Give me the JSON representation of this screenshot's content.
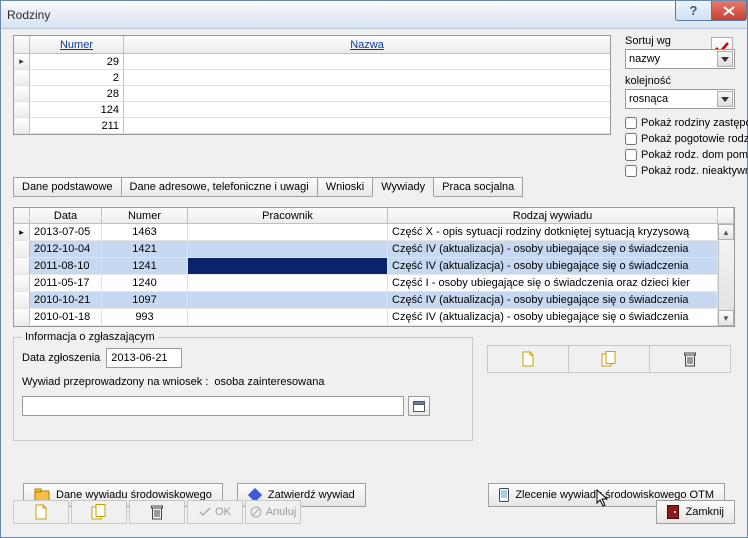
{
  "title": "Rodziny",
  "top_table": {
    "col_numer": "Numer",
    "col_nazwa": "Nazwa",
    "rows": [
      {
        "numer": "29",
        "nazwa": ""
      },
      {
        "numer": "2",
        "nazwa": ""
      },
      {
        "numer": "28",
        "nazwa": ""
      },
      {
        "numer": "124",
        "nazwa": ""
      },
      {
        "numer": "211",
        "nazwa": ""
      }
    ]
  },
  "sort": {
    "label": "Sortuj wg",
    "value": "nazwy",
    "order_label": "kolejność",
    "order_value": "rosnąca"
  },
  "checks": {
    "c1": "Pokaż rodziny zastępcze",
    "c2": "Pokaż pogotowie rodzinne",
    "c3": "Pokaż rodz. dom pomocy",
    "c4": "Pokaż rodz. nieaktywne"
  },
  "tabs": {
    "t1": "Dane podstawowe",
    "t2": "Dane adresowe, telefoniczne i uwagi",
    "t3": "Wnioski",
    "t4": "Wywiady",
    "t5": "Praca socjalna"
  },
  "grid": {
    "h_data": "Data",
    "h_numer": "Numer",
    "h_pracownik": "Pracownik",
    "h_rodzaj": "Rodzaj wywiadu",
    "rows": [
      {
        "data": "2013-07-05",
        "numer": "1463",
        "prac": "",
        "rodz": "Część X - opis sytuacji rodziny dotkniętej sytuacją kryzysową",
        "blue": false,
        "sel": false,
        "mark": "▸"
      },
      {
        "data": "2012-10-04",
        "numer": "1421",
        "prac": "",
        "rodz": "Część IV (aktualizacja) - osoby ubiegające się o świadczenia",
        "blue": true,
        "sel": false,
        "mark": ""
      },
      {
        "data": "2011-08-10",
        "numer": "1241",
        "prac": "",
        "rodz": "Część IV (aktualizacja) - osoby ubiegające się o świadczenia",
        "blue": true,
        "sel": true,
        "mark": ""
      },
      {
        "data": "2011-05-17",
        "numer": "1240",
        "prac": "",
        "rodz": "Część I - osoby ubiegające się o świadczenia oraz dzieci kier",
        "blue": false,
        "sel": false,
        "mark": ""
      },
      {
        "data": "2010-10-21",
        "numer": "1097",
        "prac": "",
        "rodz": "Część IV (aktualizacja) - osoby ubiegające się o świadczenia",
        "blue": true,
        "sel": false,
        "mark": ""
      },
      {
        "data": "2010-01-18",
        "numer": "993",
        "prac": "",
        "rodz": "Część IV (aktualizacja) - osoby ubiegające się o świadczenia",
        "blue": false,
        "sel": false,
        "mark": ""
      }
    ]
  },
  "info": {
    "legend": "Informacja o zgłaszającym",
    "data_label": "Data zgłoszenia",
    "data_value": "2013-06-21",
    "wniosek_label": "Wywiad przeprowadzony na wniosek :",
    "wniosek_value": "osoba zainteresowana"
  },
  "buttons": {
    "dane_wywiadu": "Dane wywiadu środowiskowego",
    "zatwierdz": "Zatwierdź wywiad",
    "zlecenie": "Zlecenie wywiadu środowiskowego OTM",
    "ok": "OK",
    "anuluj": "Anuluj",
    "zamknij": "Zamknij"
  }
}
